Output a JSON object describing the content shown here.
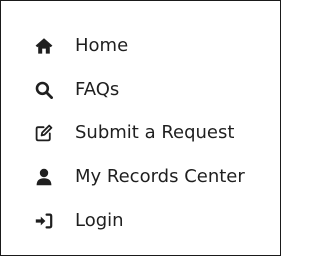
{
  "theme": {
    "text_color": "#1f1f1f",
    "icon_color": "#1f1f1f",
    "border_color": "#1a1a1a",
    "background": "#ffffff"
  },
  "nav": {
    "items": [
      {
        "label": "Home",
        "icon": "home-icon"
      },
      {
        "label": "FAQs",
        "icon": "search-icon"
      },
      {
        "label": "Submit a Request",
        "icon": "edit-icon"
      },
      {
        "label": "My Records Center",
        "icon": "user-icon"
      },
      {
        "label": "Login",
        "icon": "sign-in-icon"
      }
    ]
  }
}
